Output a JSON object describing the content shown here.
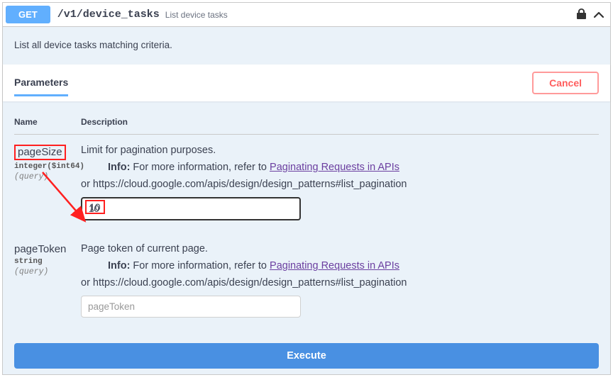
{
  "header": {
    "method": "GET",
    "path": "/v1/device_tasks",
    "summary": "List device tasks"
  },
  "description": "List all device tasks matching criteria.",
  "paramsBar": {
    "title": "Parameters",
    "cancel": "Cancel"
  },
  "tableHeader": {
    "name": "Name",
    "description": "Description"
  },
  "params": [
    {
      "name": "pageSize",
      "type": "integer($int64)",
      "in": "(query)",
      "desc": "Limit for pagination purposes.",
      "infoPrefix": "Info:",
      "infoText": " For more information, refer to ",
      "infoLink": "Paginating Requests in APIs",
      "orLine": "or https://cloud.google.com/apis/design/design_patterns#list_pagination",
      "value": "10"
    },
    {
      "name": "pageToken",
      "type": "string",
      "in": "(query)",
      "desc": "Page token of current page.",
      "infoPrefix": "Info:",
      "infoText": " For more information, refer to ",
      "infoLink": "Paginating Requests in APIs",
      "orLine": "or https://cloud.google.com/apis/design/design_patterns#list_pagination",
      "placeholder": "pageToken"
    }
  ],
  "executeLabel": "Execute"
}
